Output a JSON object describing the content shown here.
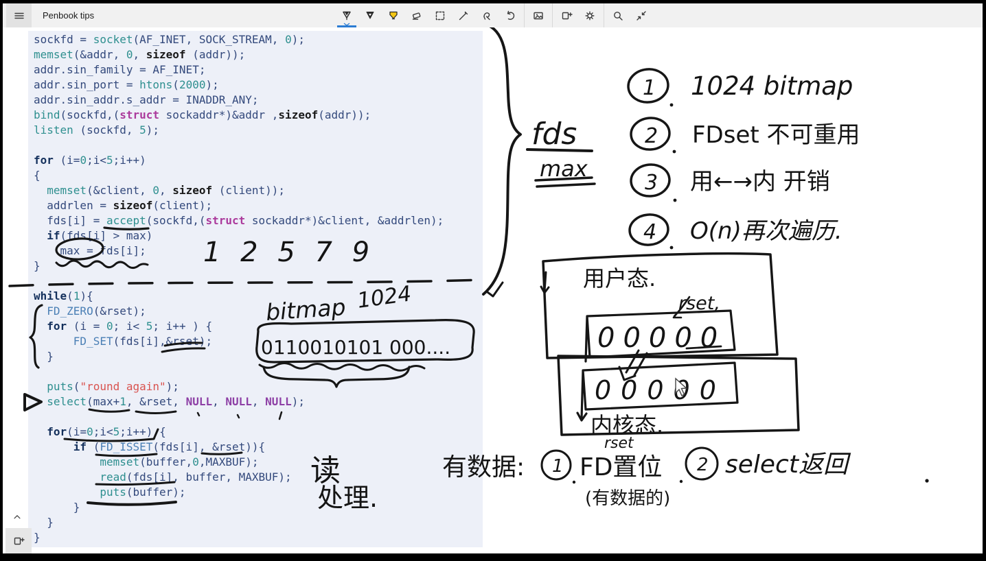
{
  "window": {
    "title": "Penbook tips"
  },
  "toolbar": {
    "icons": [
      "pen",
      "pencil",
      "highlighter",
      "eraser",
      "selection",
      "line-tool",
      "touch-write",
      "undo",
      "image",
      "add-page",
      "settings",
      "search",
      "collapse"
    ],
    "selected_icon": "pen",
    "accent_color": "#2b7cd3"
  },
  "bottom_controls": {
    "icons": [
      "chevron-up",
      "add-page"
    ]
  },
  "code": {
    "background": "#edf0f8",
    "lines": [
      [
        [
          "p",
          "sockfd = "
        ],
        [
          "f",
          "socket"
        ],
        [
          "p",
          "(AF_INET, SOCK_STREAM, "
        ],
        [
          "n",
          "0"
        ],
        [
          "p",
          ");"
        ]
      ],
      [
        [
          "f",
          "memset"
        ],
        [
          "p",
          "(&addr, "
        ],
        [
          "n",
          "0"
        ],
        [
          "p",
          ", "
        ],
        [
          "s",
          "sizeof"
        ],
        [
          "p",
          " (addr));"
        ]
      ],
      [
        [
          "p",
          "addr.sin_family = AF_INET;"
        ]
      ],
      [
        [
          "p",
          "addr.sin_port = "
        ],
        [
          "f",
          "htons"
        ],
        [
          "p",
          "("
        ],
        [
          "n",
          "2000"
        ],
        [
          "p",
          ");"
        ]
      ],
      [
        [
          "p",
          "addr.sin_addr.s_addr = INADDR_ANY;"
        ]
      ],
      [
        [
          "f",
          "bind"
        ],
        [
          "p",
          "(sockfd,("
        ],
        [
          "st",
          "struct"
        ],
        [
          "p",
          " sockaddr*)&addr ,"
        ],
        [
          "s",
          "sizeof"
        ],
        [
          "p",
          "(addr));"
        ]
      ],
      [
        [
          "f",
          "listen"
        ],
        [
          "p",
          " (sockfd, "
        ],
        [
          "n",
          "5"
        ],
        [
          "p",
          ");"
        ]
      ],
      [],
      [
        [
          "k",
          "for"
        ],
        [
          "p",
          " (i="
        ],
        [
          "n",
          "0"
        ],
        [
          "p",
          ";i<"
        ],
        [
          "n",
          "5"
        ],
        [
          "p",
          ";i++)"
        ]
      ],
      [
        [
          "p",
          "{"
        ]
      ],
      [
        [
          "p",
          "  "
        ],
        [
          "f",
          "memset"
        ],
        [
          "p",
          "(&client, "
        ],
        [
          "n",
          "0"
        ],
        [
          "p",
          ", "
        ],
        [
          "s",
          "sizeof"
        ],
        [
          "p",
          " (client));"
        ]
      ],
      [
        [
          "p",
          "  addrlen = "
        ],
        [
          "s",
          "sizeof"
        ],
        [
          "p",
          "(client);"
        ]
      ],
      [
        [
          "p",
          "  fds[i] = "
        ],
        [
          "f",
          "accept"
        ],
        [
          "p",
          "(sockfd,("
        ],
        [
          "st",
          "struct"
        ],
        [
          "p",
          " sockaddr*)&client, &addrlen);"
        ]
      ],
      [
        [
          "p",
          "  "
        ],
        [
          "k",
          "if"
        ],
        [
          "p",
          "(fds[i] > max)"
        ]
      ],
      [
        [
          "p",
          "    max = fds[i];"
        ]
      ],
      [
        [
          "p",
          "}"
        ]
      ],
      [],
      [
        [
          "k",
          "while"
        ],
        [
          "p",
          "("
        ],
        [
          "n",
          "1"
        ],
        [
          "p",
          "){"
        ]
      ],
      [
        [
          "p",
          "  "
        ],
        [
          "m",
          "FD_ZERO"
        ],
        [
          "p",
          "(&rset);"
        ]
      ],
      [
        [
          "p",
          "  "
        ],
        [
          "k",
          "for"
        ],
        [
          "p",
          " (i = "
        ],
        [
          "n",
          "0"
        ],
        [
          "p",
          "; i< "
        ],
        [
          "n",
          "5"
        ],
        [
          "p",
          "; i++ ) {"
        ]
      ],
      [
        [
          "p",
          "      "
        ],
        [
          "m",
          "FD_SET"
        ],
        [
          "p",
          "(fds[i],&rset);"
        ]
      ],
      [
        [
          "p",
          "  }"
        ]
      ],
      [],
      [
        [
          "p",
          "  "
        ],
        [
          "f",
          "puts"
        ],
        [
          "p",
          "("
        ],
        [
          "str",
          "\"round again\""
        ],
        [
          "p",
          ");"
        ]
      ],
      [
        [
          "p",
          "  "
        ],
        [
          "f",
          "select"
        ],
        [
          "p",
          "(max+"
        ],
        [
          "n",
          "1"
        ],
        [
          "p",
          ", &rset, "
        ],
        [
          "nl",
          "NULL"
        ],
        [
          "p",
          ", "
        ],
        [
          "nl",
          "NULL"
        ],
        [
          "p",
          ", "
        ],
        [
          "nl",
          "NULL"
        ],
        [
          "p",
          ");"
        ]
      ],
      [],
      [
        [
          "p",
          "  "
        ],
        [
          "k",
          "for"
        ],
        [
          "p",
          "(i="
        ],
        [
          "n",
          "0"
        ],
        [
          "p",
          ";i<"
        ],
        [
          "n",
          "5"
        ],
        [
          "p",
          ";i++) {"
        ]
      ],
      [
        [
          "p",
          "      "
        ],
        [
          "k",
          "if"
        ],
        [
          "p",
          " ("
        ],
        [
          "m",
          "FD_ISSET"
        ],
        [
          "p",
          "(fds[i], &rset)){"
        ]
      ],
      [
        [
          "p",
          "          "
        ],
        [
          "f",
          "memset"
        ],
        [
          "p",
          "(buffer,"
        ],
        [
          "n",
          "0"
        ],
        [
          "p",
          ",MAXBUF);"
        ]
      ],
      [
        [
          "p",
          "          "
        ],
        [
          "f",
          "read"
        ],
        [
          "p",
          "(fds[i], buffer, MAXBUF);"
        ]
      ],
      [
        [
          "p",
          "          "
        ],
        [
          "f",
          "puts"
        ],
        [
          "p",
          "(buffer);"
        ]
      ],
      [
        [
          "p",
          "      }"
        ]
      ],
      [
        [
          "p",
          "  }"
        ]
      ],
      [
        [
          "p",
          "}"
        ]
      ]
    ]
  },
  "annotations": {
    "nums": "1 2 5 7 9",
    "bitmap_label": "bitmap",
    "bitmap_count": "1024",
    "bitmap_bits": "0110010101 000....",
    "brace_fds": "fds",
    "brace_max": "max",
    "circ1": "1",
    "circ2": "2",
    "circ3": "3",
    "circ4": "4",
    "note1": "1024 bitmap",
    "note2": "FDset 不可重用",
    "note3": "用←→内 开销",
    "note4": "O(n)再次遍历.",
    "user_mode": "用户态.",
    "rset_label": "rset,",
    "bits_user": "00000",
    "bits_kernel": "00000",
    "kernel_mode": "内核态.",
    "read_note": "读",
    "process_note": "处理.",
    "bottom_prefix": "有数据:",
    "bottom_c1": "1",
    "bottom_rset": "rset",
    "bottom_item1": "FD置位",
    "bottom_sub": "(有数据的)",
    "bottom_c2": "2",
    "bottom_item2": "select返回"
  }
}
